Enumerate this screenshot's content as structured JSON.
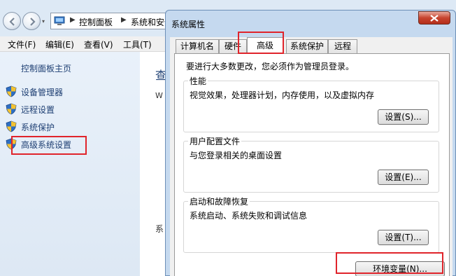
{
  "explorer": {
    "breadcrumb": [
      "控制面板",
      "系统和安全"
    ],
    "menu": [
      "文件(F)",
      "编辑(E)",
      "查看(V)",
      "工具(T)"
    ],
    "sidebar": {
      "home": "控制面板主页",
      "items": [
        {
          "label": "设备管理器",
          "icon": "uac-shield-icon"
        },
        {
          "label": "远程设置",
          "icon": "uac-shield-icon"
        },
        {
          "label": "系统保护",
          "icon": "uac-shield-icon"
        },
        {
          "label": "高级系统设置",
          "icon": "uac-shield-icon"
        }
      ]
    },
    "content": {
      "title": "查",
      "subtitle": "W",
      "section": "系"
    }
  },
  "dialog": {
    "title": "系统属性",
    "tabs": [
      "计算机名",
      "硬件",
      "高级",
      "系统保护",
      "远程"
    ],
    "active_tab": "高级",
    "notice": "要进行大多数更改，您必须作为管理员登录。",
    "groups": [
      {
        "title": "性能",
        "description": "视觉效果，处理器计划，内存使用，以及虚拟内存",
        "button": "设置(S)..."
      },
      {
        "title": "用户配置文件",
        "description": "与您登录相关的桌面设置",
        "button": "设置(E)..."
      },
      {
        "title": "启动和故障恢复",
        "description": "系统启动、系统失败和调试信息",
        "button": "设置(T)..."
      }
    ],
    "env_button": "环境变量(N)..."
  },
  "colors": {
    "highlight_box": "#e0242b",
    "link": "#1e3f73",
    "dialog_frame": "#c5d9ef"
  }
}
